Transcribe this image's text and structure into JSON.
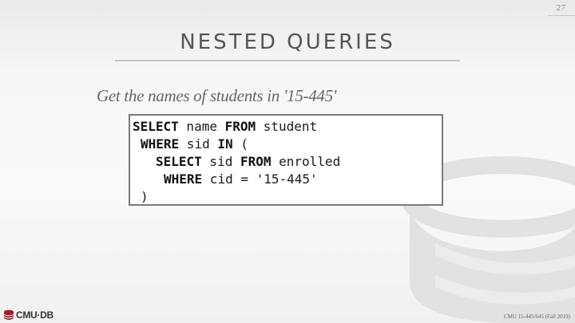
{
  "page_number": "27",
  "title": "NESTED QUERIES",
  "subtitle": "Get the names of students in '15-445'",
  "code": {
    "line1": {
      "kw1": "SELECT",
      "t1": " name ",
      "kw2": "FROM",
      "t2": " student"
    },
    "line2": {
      "kw1": "WHERE",
      "t1": " sid ",
      "kw2": "IN",
      "t2": " ("
    },
    "line3": {
      "kw1": "SELECT",
      "t1": " sid ",
      "kw2": "FROM",
      "t2": " enrolled"
    },
    "line4": {
      "kw1": "WHERE",
      "t1": " cid = '15-445'"
    },
    "line5": {
      "t1": ")"
    }
  },
  "footer": {
    "logo_text": "CMU·DB",
    "course": "CMU 15-445/645 (Fall 2019)"
  },
  "colors": {
    "title": "#555555",
    "logo_red": "#a6192e"
  }
}
